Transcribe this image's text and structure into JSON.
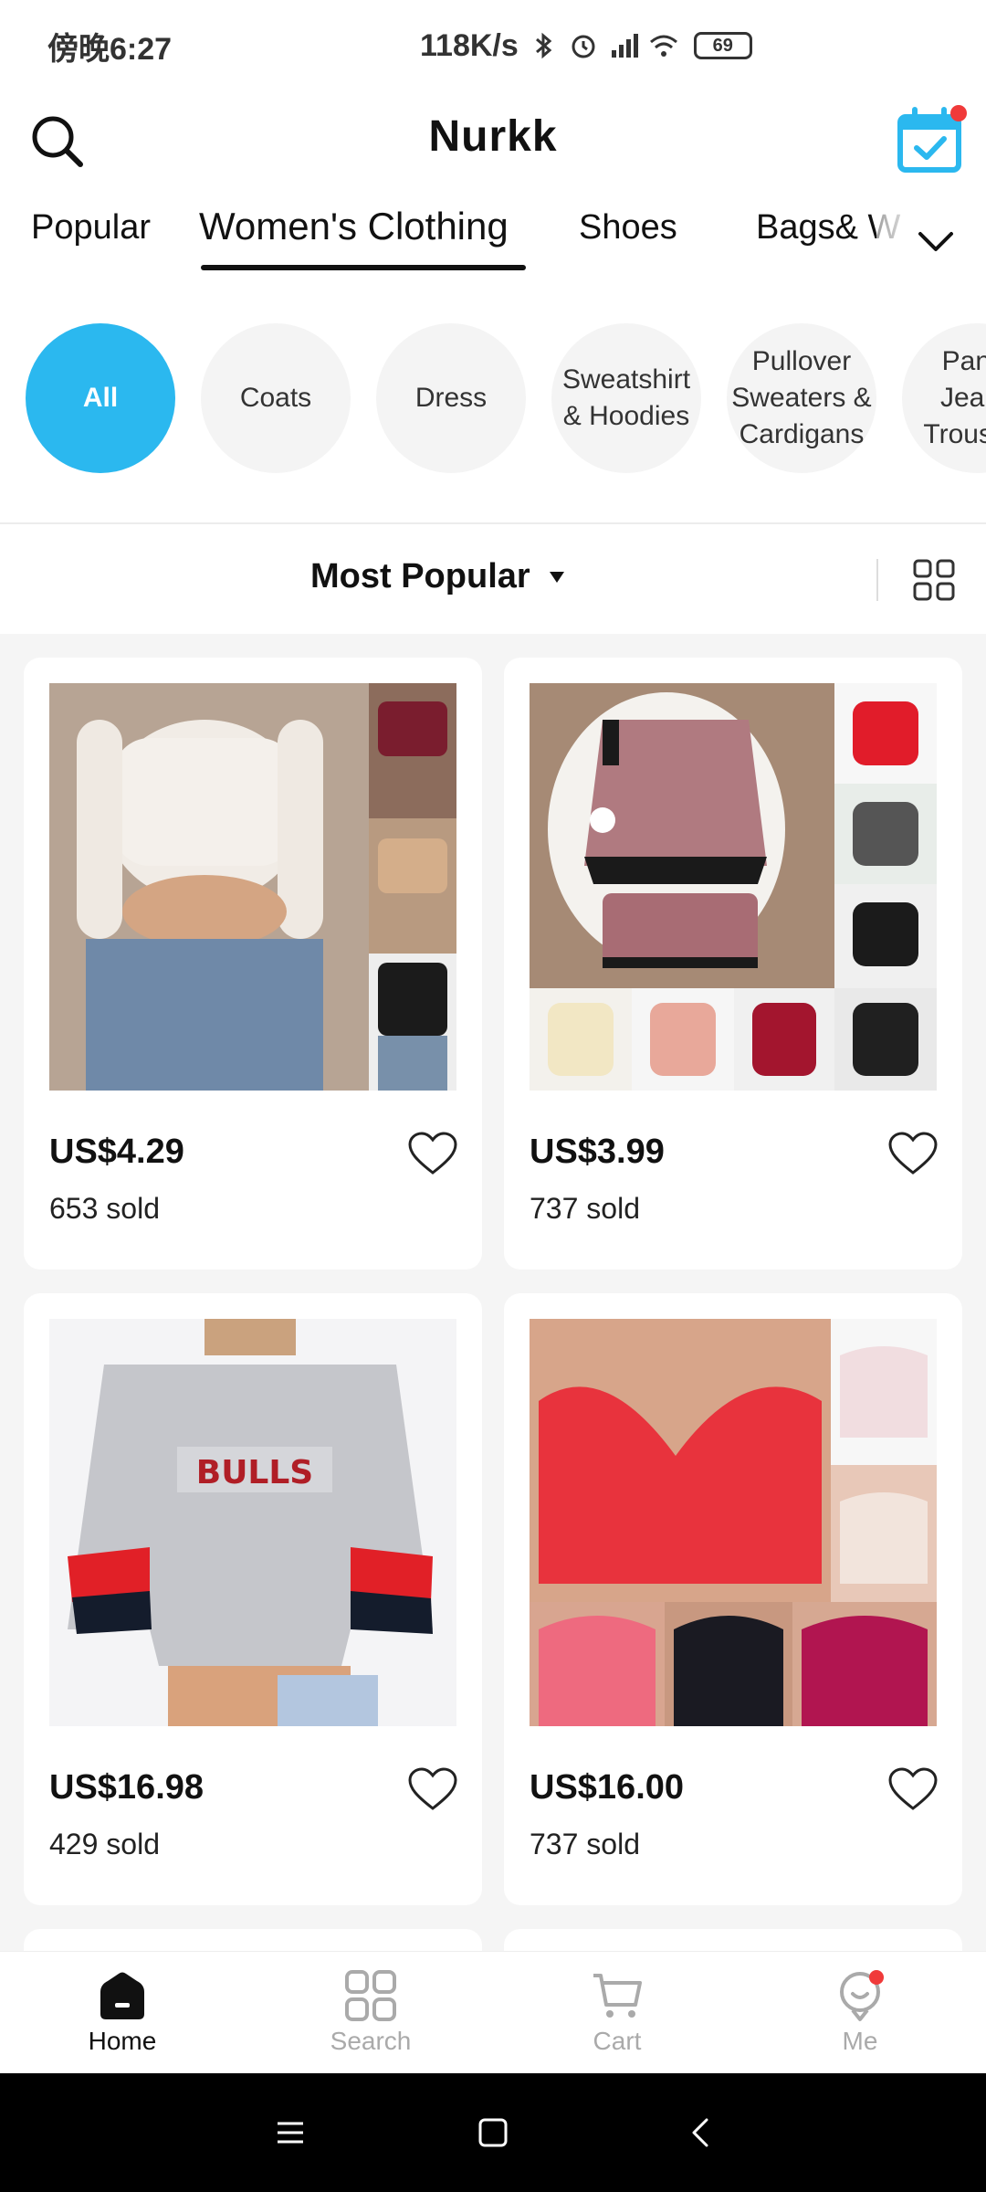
{
  "status_bar": {
    "time": "傍晚6:27",
    "network_speed": "118K/s",
    "battery": "69"
  },
  "header": {
    "title": "Nurkk"
  },
  "categories": {
    "tabs": [
      "Popular",
      "Women's Clothing",
      "Shoes",
      "Bags& W"
    ],
    "active": "Women's Clothing"
  },
  "subcategories": {
    "items": [
      "All",
      "Coats",
      "Dress",
      "Sweatshirt & Hoodies",
      "Pullover Sweaters & Cardigans",
      "Pants Jeans Trousers"
    ],
    "active": "All"
  },
  "sort": {
    "label": "Most Popular"
  },
  "products": [
    {
      "price": "US$4.29",
      "sold": "653 sold"
    },
    {
      "price": "US$3.99",
      "sold": "737 sold"
    },
    {
      "price": "US$16.98",
      "sold": "429 sold"
    },
    {
      "price": "US$16.00",
      "sold": "737 sold"
    }
  ],
  "bottom_nav": {
    "items": [
      "Home",
      "Search",
      "Cart",
      "Me"
    ],
    "active": "Home"
  },
  "colors": {
    "accent": "#2bb8ef",
    "badge": "#f03a3a"
  }
}
